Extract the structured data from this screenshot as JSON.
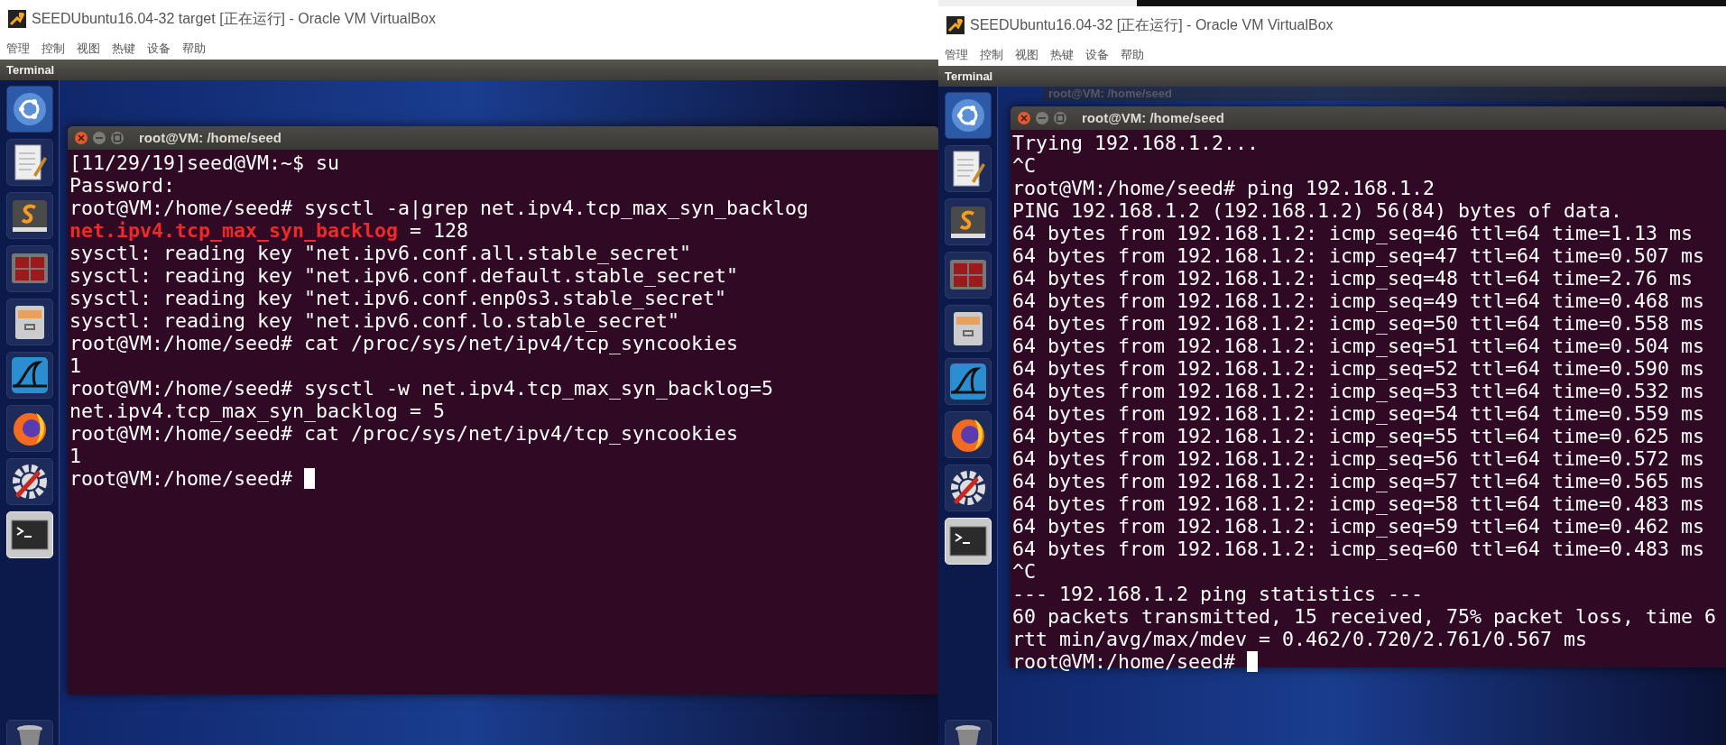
{
  "windows": [
    {
      "title": "SEEDUbuntu16.04-32 target [正在运行] - Oracle VM VirtualBox",
      "menu": [
        "管理",
        "控制",
        "视图",
        "热键",
        "设备",
        "帮助"
      ],
      "panel_title": "Terminal",
      "terminal": {
        "title": "root@VM: /home/seed",
        "lines": [
          {
            "parts": [
              {
                "text": "[11/29/19]seed@VM:~$ su",
                "highlight": false
              }
            ]
          },
          {
            "parts": [
              {
                "text": "Password:",
                "highlight": false
              }
            ]
          },
          {
            "parts": [
              {
                "text": "root@VM:/home/seed# sysctl -a|grep net.ipv4.tcp_max_syn_backlog",
                "highlight": false
              }
            ]
          },
          {
            "parts": [
              {
                "text": "net.ipv4.tcp_max_syn_backlog",
                "highlight": true
              },
              {
                "text": " = 128",
                "highlight": false
              }
            ]
          },
          {
            "parts": [
              {
                "text": "sysctl: reading key \"net.ipv6.conf.all.stable_secret\"",
                "highlight": false
              }
            ]
          },
          {
            "parts": [
              {
                "text": "sysctl: reading key \"net.ipv6.conf.default.stable_secret\"",
                "highlight": false
              }
            ]
          },
          {
            "parts": [
              {
                "text": "sysctl: reading key \"net.ipv6.conf.enp0s3.stable_secret\"",
                "highlight": false
              }
            ]
          },
          {
            "parts": [
              {
                "text": "sysctl: reading key \"net.ipv6.conf.lo.stable_secret\"",
                "highlight": false
              }
            ]
          },
          {
            "parts": [
              {
                "text": "root@VM:/home/seed# cat /proc/sys/net/ipv4/tcp_syncookies",
                "highlight": false
              }
            ]
          },
          {
            "parts": [
              {
                "text": "1",
                "highlight": false
              }
            ]
          },
          {
            "parts": [
              {
                "text": "root@VM:/home/seed# sysctl -w net.ipv4.tcp_max_syn_backlog=5",
                "highlight": false
              }
            ]
          },
          {
            "parts": [
              {
                "text": "net.ipv4.tcp_max_syn_backlog = 5",
                "highlight": false
              }
            ]
          },
          {
            "parts": [
              {
                "text": "root@VM:/home/seed# cat /proc/sys/net/ipv4/tcp_syncookies",
                "highlight": false
              }
            ]
          },
          {
            "parts": [
              {
                "text": "1",
                "highlight": false
              }
            ]
          }
        ],
        "prompt": "root@VM:/home/seed#"
      }
    },
    {
      "title": "SEEDUbuntu16.04-32 [正在运行] - Oracle VM VirtualBox",
      "menu": [
        "管理",
        "控制",
        "视图",
        "热键",
        "设备",
        "帮助"
      ],
      "panel_title": "Terminal",
      "background_window_title": "root@VM: /home/seed",
      "terminal": {
        "title": "root@VM: /home/seed",
        "lines": [
          {
            "parts": [
              {
                "text": "Trying 192.168.1.2...",
                "highlight": false
              }
            ]
          },
          {
            "parts": [
              {
                "text": "^C",
                "highlight": false
              }
            ]
          },
          {
            "parts": [
              {
                "text": "root@VM:/home/seed# ping 192.168.1.2",
                "highlight": false
              }
            ]
          },
          {
            "parts": [
              {
                "text": "PING 192.168.1.2 (192.168.1.2) 56(84) bytes of data.",
                "highlight": false
              }
            ]
          },
          {
            "parts": [
              {
                "text": "64 bytes from 192.168.1.2: icmp_seq=46 ttl=64 time=1.13 ms",
                "highlight": false
              }
            ]
          },
          {
            "parts": [
              {
                "text": "64 bytes from 192.168.1.2: icmp_seq=47 ttl=64 time=0.507 ms",
                "highlight": false
              }
            ]
          },
          {
            "parts": [
              {
                "text": "64 bytes from 192.168.1.2: icmp_seq=48 ttl=64 time=2.76 ms",
                "highlight": false
              }
            ]
          },
          {
            "parts": [
              {
                "text": "64 bytes from 192.168.1.2: icmp_seq=49 ttl=64 time=0.468 ms",
                "highlight": false
              }
            ]
          },
          {
            "parts": [
              {
                "text": "64 bytes from 192.168.1.2: icmp_seq=50 ttl=64 time=0.558 ms",
                "highlight": false
              }
            ]
          },
          {
            "parts": [
              {
                "text": "64 bytes from 192.168.1.2: icmp_seq=51 ttl=64 time=0.504 ms",
                "highlight": false
              }
            ]
          },
          {
            "parts": [
              {
                "text": "64 bytes from 192.168.1.2: icmp_seq=52 ttl=64 time=0.590 ms",
                "highlight": false
              }
            ]
          },
          {
            "parts": [
              {
                "text": "64 bytes from 192.168.1.2: icmp_seq=53 ttl=64 time=0.532 ms",
                "highlight": false
              }
            ]
          },
          {
            "parts": [
              {
                "text": "64 bytes from 192.168.1.2: icmp_seq=54 ttl=64 time=0.559 ms",
                "highlight": false
              }
            ]
          },
          {
            "parts": [
              {
                "text": "64 bytes from 192.168.1.2: icmp_seq=55 ttl=64 time=0.625 ms",
                "highlight": false
              }
            ]
          },
          {
            "parts": [
              {
                "text": "64 bytes from 192.168.1.2: icmp_seq=56 ttl=64 time=0.572 ms",
                "highlight": false
              }
            ]
          },
          {
            "parts": [
              {
                "text": "64 bytes from 192.168.1.2: icmp_seq=57 ttl=64 time=0.565 ms",
                "highlight": false
              }
            ]
          },
          {
            "parts": [
              {
                "text": "64 bytes from 192.168.1.2: icmp_seq=58 ttl=64 time=0.483 ms",
                "highlight": false
              }
            ]
          },
          {
            "parts": [
              {
                "text": "64 bytes from 192.168.1.2: icmp_seq=59 ttl=64 time=0.462 ms",
                "highlight": false
              }
            ]
          },
          {
            "parts": [
              {
                "text": "64 bytes from 192.168.1.2: icmp_seq=60 ttl=64 time=0.483 ms",
                "highlight": false
              }
            ]
          },
          {
            "parts": [
              {
                "text": "^C",
                "highlight": false
              }
            ]
          },
          {
            "parts": [
              {
                "text": "--- 192.168.1.2 ping statistics ---",
                "highlight": false
              }
            ]
          },
          {
            "parts": [
              {
                "text": "60 packets transmitted, 15 received, 75% packet loss, time 6",
                "highlight": false
              }
            ]
          },
          {
            "parts": [
              {
                "text": "rtt min/avg/max/mdev = 0.462/0.720/2.761/0.567 ms",
                "highlight": false
              }
            ]
          }
        ],
        "prompt": "root@VM:/home/seed#"
      }
    }
  ]
}
